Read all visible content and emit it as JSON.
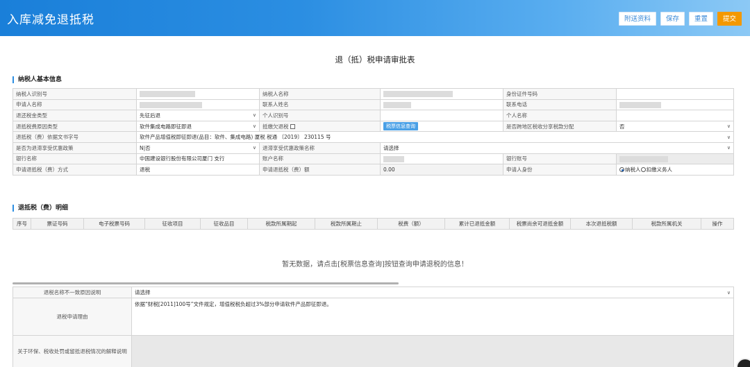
{
  "header": {
    "title": "入库减免退抵税",
    "buttons": [
      "附送资料",
      "保存",
      "重置",
      "提交"
    ]
  },
  "form_title": "退（抵）税申请审批表",
  "section_taxpayer": "纳税人基本信息",
  "info_rows": [
    [
      "纳税人识别号",
      "",
      "纳税人名称",
      "",
      "身份证件号码",
      ""
    ],
    [
      "申请人名称",
      "",
      "联系人姓名",
      "",
      "联系电话",
      ""
    ],
    [
      "退还税金类型",
      "先征后退",
      "个人识别号",
      "",
      "个人名称",
      ""
    ],
    [
      "退抵税费原因类型",
      "软件集成电路即征即退",
      "抵缴欠退税",
      "税票信息查询",
      "是否跨地区税收分享税款分配",
      "否"
    ],
    [
      "退抵税（费）依据文书字号",
      "软件产品增值税即征即退(品目：软件、集成电路) 厦税 税通 〔2019〕 230115 号"
    ],
    [
      "是否为退滞享受优惠政策",
      "N|否",
      "退滞享受优惠政策名称",
      "请选择"
    ],
    [
      "银行名称",
      "中国建设银行股份有限公司厦门        支行",
      "账户名称",
      "",
      "银行账号",
      ""
    ],
    [
      "申请退抵税（费）方式",
      "退税",
      "申请退抵税（费）额",
      "0.00",
      "申请人身份",
      "纳税人",
      "扣缴义务人"
    ]
  ],
  "section_detail": "退抵税（费）明细",
  "detail_headers": [
    "序号",
    "票证号码",
    "电子税票号码",
    "征收项目",
    "征收品目",
    "税款所属期起",
    "税款所属期止",
    "税费（额）",
    "累计已退抵金额",
    "税票尚余可退抵金额",
    "本次退抵税额",
    "税款所属机关",
    "操作"
  ],
  "empty_message": "暂无数据，请点击[税票信息查询]按钮查询申请退税的信息！",
  "bottom": {
    "reason_mismatch_label": "退税名称不一致原因说明",
    "reason_mismatch_value": "请选择",
    "apply_reason_label": "退税申请理由",
    "apply_reason_value": "依据“财税[2011]100号”文件规定，增值税税负超过3%部分申请软件产品即征即退。",
    "env_label": "关于环保、税收处罚或留抵退税情况的解释说明"
  }
}
